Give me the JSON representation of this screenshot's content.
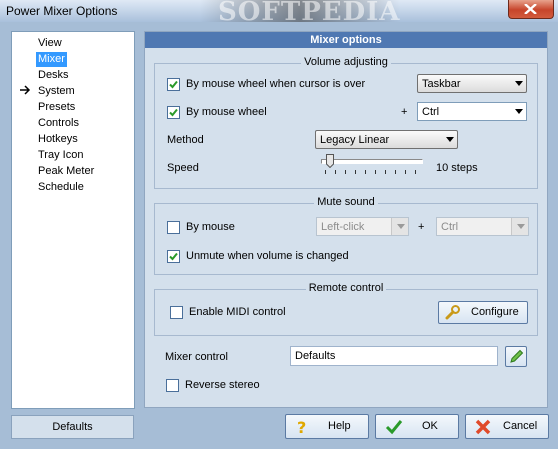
{
  "window": {
    "title": "Power Mixer Options",
    "watermark": "SOFTPEDIA"
  },
  "nav": {
    "items": [
      {
        "label": "View"
      },
      {
        "label": "Mixer",
        "selected": true
      },
      {
        "label": "Desks"
      },
      {
        "label": "System"
      },
      {
        "label": "Presets"
      },
      {
        "label": "Controls"
      },
      {
        "label": "Hotkeys"
      },
      {
        "label": "Tray Icon"
      },
      {
        "label": "Peak Meter"
      },
      {
        "label": "Schedule"
      }
    ]
  },
  "main": {
    "header": "Mixer options",
    "volume": {
      "title": "Volume adjusting",
      "cursor_over": {
        "label": "By mouse wheel when cursor is over",
        "checked": true,
        "value": "Taskbar"
      },
      "mouse_wheel": {
        "label": "By mouse wheel",
        "checked": true,
        "plus": "+",
        "value": "Ctrl"
      },
      "method": {
        "label": "Method",
        "value": "Legacy Linear"
      },
      "speed": {
        "label": "Speed",
        "value_text": "10 steps",
        "level": 0.05
      }
    },
    "mute": {
      "title": "Mute sound",
      "by_mouse": {
        "label": "By mouse",
        "checked": false,
        "value": "Left-click",
        "plus": "+",
        "modifier": "Ctrl"
      },
      "unmute": {
        "label": "Unmute when volume is changed",
        "checked": true
      }
    },
    "remote": {
      "title": "Remote control",
      "midi": {
        "label": "Enable MIDI control",
        "checked": false
      },
      "configure": "Configure"
    },
    "mixer_control": {
      "label": "Mixer control",
      "value": "Defaults"
    },
    "reverse_stereo": {
      "label": "Reverse stereo",
      "checked": false
    }
  },
  "footer": {
    "defaults": "Defaults",
    "help": "Help",
    "ok": "OK",
    "cancel": "Cancel"
  },
  "colors": {
    "header_bg": "#4f78b2",
    "selection": "#3399ff",
    "panel_bg": "#d4e0ec"
  }
}
